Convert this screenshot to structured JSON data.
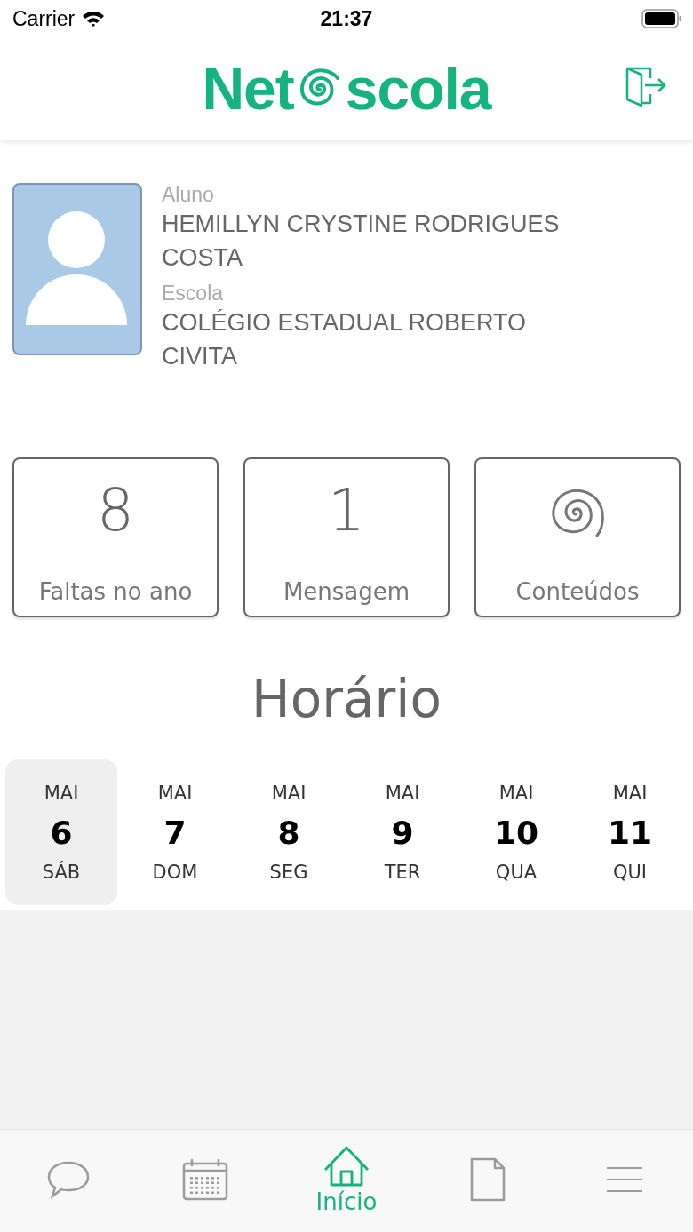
{
  "status_bar": {
    "carrier": "Carrier",
    "time": "21:37"
  },
  "header": {
    "logo_left": "Net",
    "logo_right": "scola"
  },
  "student": {
    "label": "Aluno",
    "name": "HEMILLYN CRYSTINE RODRIGUES COSTA",
    "school_label": "Escola",
    "school": "COLÉGIO ESTADUAL ROBERTO CIVITA"
  },
  "tiles": [
    {
      "kind": "count",
      "value": "8",
      "label": "Faltas no ano"
    },
    {
      "kind": "count",
      "value": "1",
      "label": "Mensagem"
    },
    {
      "kind": "icon",
      "label": "Conteúdos"
    }
  ],
  "schedule": {
    "title": "Horário",
    "days": [
      {
        "month": "MAI",
        "day": "6",
        "weekday": "SÁB",
        "selected": true
      },
      {
        "month": "MAI",
        "day": "7",
        "weekday": "DOM",
        "selected": false
      },
      {
        "month": "MAI",
        "day": "8",
        "weekday": "SEG",
        "selected": false
      },
      {
        "month": "MAI",
        "day": "9",
        "weekday": "TER",
        "selected": false
      },
      {
        "month": "MAI",
        "day": "10",
        "weekday": "QUA",
        "selected": false
      },
      {
        "month": "MAI",
        "day": "11",
        "weekday": "QUI",
        "selected": false
      }
    ]
  },
  "tab_bar": [
    {
      "kind": "chat",
      "selected": false
    },
    {
      "kind": "calendar",
      "selected": false
    },
    {
      "kind": "home",
      "label": "Início",
      "selected": true
    },
    {
      "kind": "document",
      "selected": false
    },
    {
      "kind": "menu",
      "selected": false
    }
  ]
}
